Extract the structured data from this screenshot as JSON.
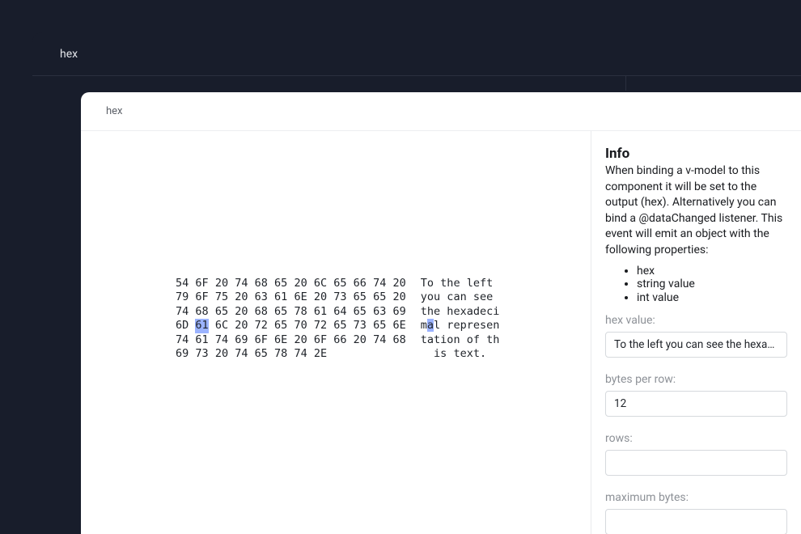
{
  "outerTitle": "hex",
  "innerTitle": "hex",
  "hex": {
    "bytesPerRow": 12,
    "selectedIndex": 37,
    "bytes": [
      [
        "54",
        "6F",
        "20",
        "74",
        "68",
        "65",
        "20",
        "6C",
        "65",
        "66",
        "74",
        "20"
      ],
      [
        "79",
        "6F",
        "75",
        "20",
        "63",
        "61",
        "6E",
        "20",
        "73",
        "65",
        "65",
        "20"
      ],
      [
        "74",
        "68",
        "65",
        "20",
        "68",
        "65",
        "78",
        "61",
        "64",
        "65",
        "63",
        "69"
      ],
      [
        "6D",
        "61",
        "6C",
        "20",
        "72",
        "65",
        "70",
        "72",
        "65",
        "73",
        "65",
        "6E"
      ],
      [
        "74",
        "61",
        "74",
        "69",
        "6F",
        "6E",
        "20",
        "6F",
        "66",
        "20",
        "74",
        "68"
      ],
      [
        "69",
        "73",
        "20",
        "74",
        "65",
        "78",
        "74",
        "2E"
      ]
    ],
    "ascii": [
      "To the left ",
      "you can see ",
      "the hexadeci",
      "mal represen",
      "tation of th",
      "is text."
    ]
  },
  "info": {
    "title": "Info",
    "description": "When binding a v-model to this component it will be set to the output (hex). Alternatively you can bind a @dataChanged listener. This event will emit an object with the following properties:",
    "properties": [
      "hex",
      "string value",
      "int value"
    ],
    "fields": {
      "hexValue": {
        "label": "hex value:",
        "value": "To the left you can see the hexadecimal representation of this text."
      },
      "bytesPerRow": {
        "label": "bytes per row:",
        "value": "12"
      },
      "rows": {
        "label": "rows:",
        "value": ""
      },
      "maximumBytes": {
        "label": "maximum bytes:",
        "value": ""
      }
    }
  }
}
